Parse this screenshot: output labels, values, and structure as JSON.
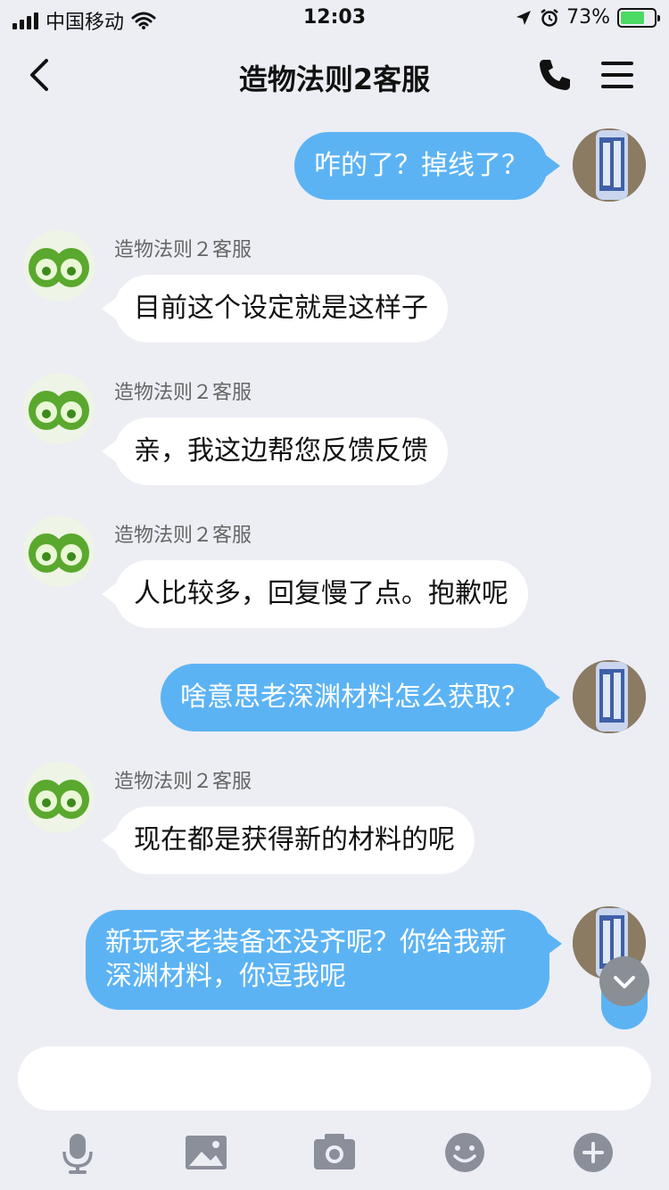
{
  "status_bar": {
    "carrier": "中国移动",
    "time": "12:03",
    "battery_percent": "73%",
    "battery_level": 0.73
  },
  "header": {
    "title": "造物法则2客服"
  },
  "messages": [
    {
      "direction": "out",
      "text": "咋的了？掉线了？"
    },
    {
      "direction": "in",
      "sender": "造物法则２客服",
      "text": "目前这个设定就是这样子"
    },
    {
      "direction": "in",
      "sender": "造物法则２客服",
      "text": "亲，我这边帮您反馈反馈"
    },
    {
      "direction": "in",
      "sender": "造物法则２客服",
      "text": "人比较多，回复慢了点。抱歉呢"
    },
    {
      "direction": "out",
      "text": "啥意思老深渊材料怎么获取？"
    },
    {
      "direction": "in",
      "sender": "造物法则２客服",
      "text": "现在都是获得新的材料的呢"
    },
    {
      "direction": "out",
      "text": "新玩家老装备还没齐呢？你给我新深渊材料，你逗我呢"
    }
  ],
  "input": {
    "placeholder": ""
  },
  "toolbar": [
    "microphone-icon",
    "image-icon",
    "camera-icon",
    "emoji-icon",
    "plus-icon"
  ],
  "colors": {
    "background": "#eceef4",
    "outgoing_bubble": "#5cb3f4",
    "incoming_bubble": "#ffffff",
    "toolbar_icon": "#8a8f9a"
  }
}
